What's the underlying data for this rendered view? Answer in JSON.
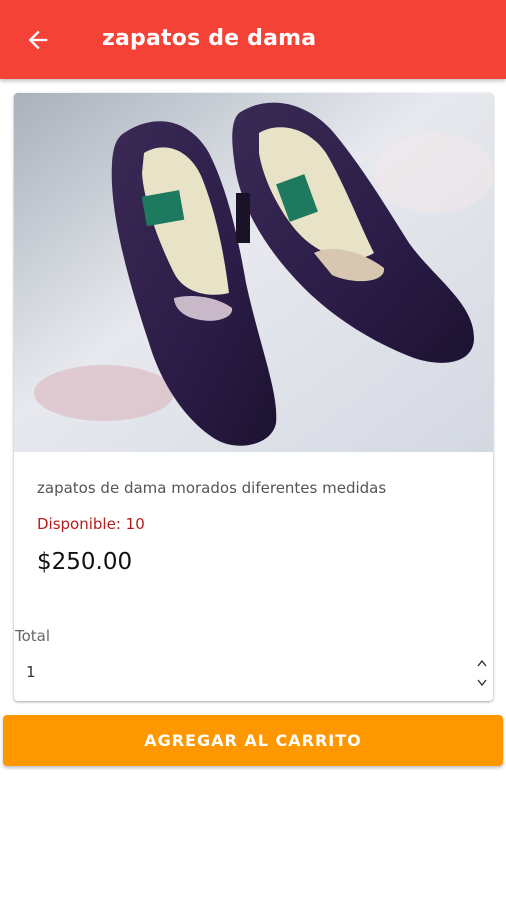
{
  "app_bar": {
    "title": "zapatos de dama",
    "back_icon": "arrow-back-icon",
    "background": "#f44336"
  },
  "product": {
    "image_alt": "product-photo",
    "description": "zapatos de dama morados diferentes medidas",
    "availability": "Disponible: 10",
    "price": "$250.00"
  },
  "quantity": {
    "label": "Total",
    "value": "1"
  },
  "actions": {
    "add_to_cart_label": "AGREGAR AL CARRITO",
    "button_color": "#ff9800"
  }
}
